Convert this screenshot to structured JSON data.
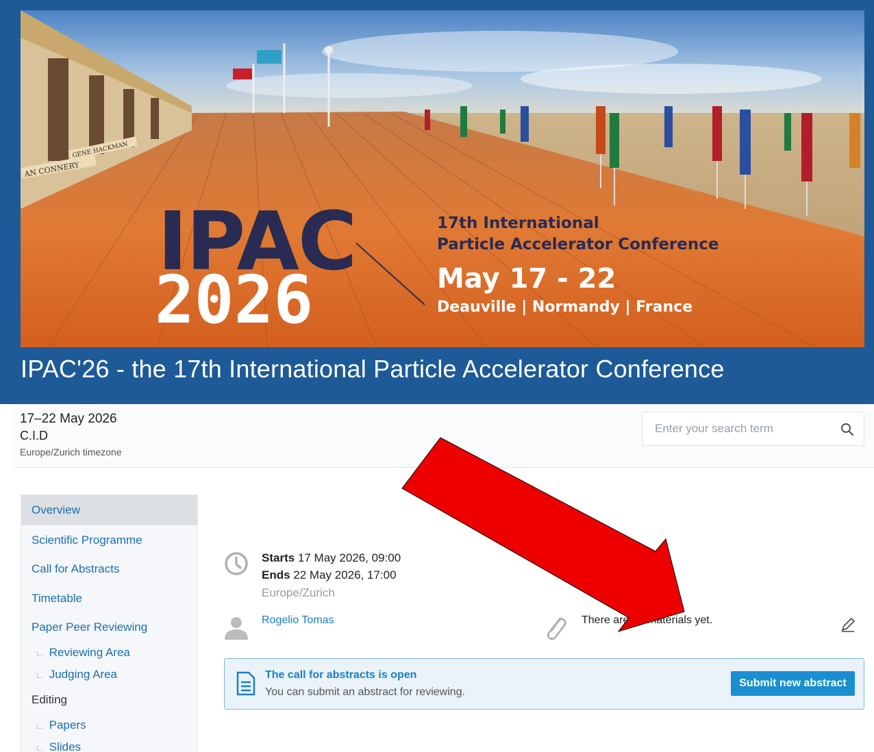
{
  "banner": {
    "logo_line1": "IPAC",
    "logo_line2": "2026",
    "subtitle_line1": "17th International",
    "subtitle_line2": "Particle Accelerator Conference",
    "dates": "May 17 - 22",
    "location": "Deauville | Normandy | France",
    "sign1": "AN CONNERY",
    "sign2": "GENE HACKMAN"
  },
  "event": {
    "title": "IPAC'26 - the 17th International Particle Accelerator Conference",
    "date_range": "17–22 May 2026",
    "venue": "C.I.D",
    "timezone": "Europe/Zurich timezone"
  },
  "search": {
    "placeholder": "Enter your search term"
  },
  "sidebar": {
    "items": [
      {
        "label": "Overview"
      },
      {
        "label": "Scientific Programme"
      },
      {
        "label": "Call for Abstracts"
      },
      {
        "label": "Timetable"
      },
      {
        "label": "Paper Peer Reviewing"
      },
      {
        "label": "Reviewing Area"
      },
      {
        "label": "Judging Area"
      },
      {
        "label": "Editing"
      },
      {
        "label": "Papers"
      },
      {
        "label": "Slides"
      }
    ]
  },
  "details": {
    "starts_label": "Starts",
    "starts_value": "17 May 2026, 09:00",
    "ends_label": "Ends",
    "ends_value": "22 May 2026, 17:00",
    "tz": "Europe/Zurich",
    "chair": "Rogelio Tomas",
    "materials": "There are no materials yet."
  },
  "cfa": {
    "title": "The call for abstracts is open",
    "text": "You can submit an abstract for reviewing.",
    "button": "Submit new abstract"
  },
  "colors": {
    "header": "#1d5a97",
    "link": "#1a7fc1",
    "button": "#1a8fd0",
    "logo_navy": "#2a2b52",
    "arrow": "#ee0000"
  }
}
